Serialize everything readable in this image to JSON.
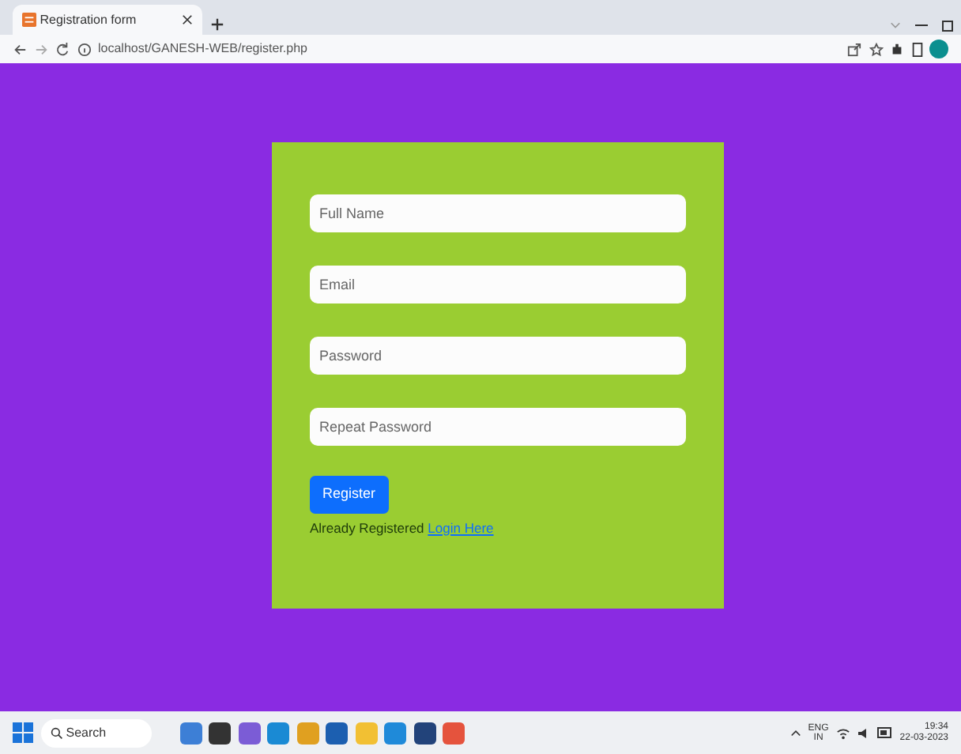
{
  "browser": {
    "tabs": [
      {
        "title": "Registration form",
        "selected": true
      }
    ],
    "address": "localhost/GANESH-WEB/register.php"
  },
  "form": {
    "fields": [
      {
        "placeholder": "Full Name"
      },
      {
        "placeholder": "Email"
      },
      {
        "placeholder": "Password"
      },
      {
        "placeholder": "Repeat Password"
      }
    ],
    "button": "Register",
    "footer_text": "Already Registered",
    "footer_link": "Login Here"
  },
  "taskbar": {
    "search": "Search",
    "language": "ENG",
    "region": "IN",
    "time": "19:34",
    "date": "22-03-2023"
  }
}
